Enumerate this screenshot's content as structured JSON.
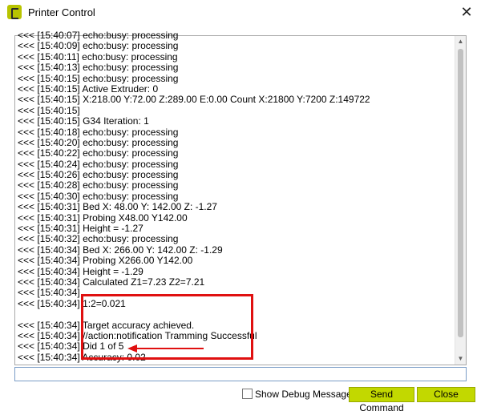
{
  "window": {
    "title": "Printer Control",
    "close_glyph": "✕",
    "icon": "cura-logo-icon"
  },
  "console": {
    "lines": [
      "<<< [15:40:07] echo:busy: processing",
      "<<< [15:40:09] echo:busy: processing",
      "<<< [15:40:11] echo:busy: processing",
      "<<< [15:40:13] echo:busy: processing",
      "<<< [15:40:15] echo:busy: processing",
      "<<< [15:40:15] Active Extruder: 0",
      "<<< [15:40:15] X:218.00 Y:72.00 Z:289.00 E:0.00 Count X:21800 Y:7200 Z:149722",
      "<<< [15:40:15]",
      "<<< [15:40:15] G34 Iteration: 1",
      "<<< [15:40:18] echo:busy: processing",
      "<<< [15:40:20] echo:busy: processing",
      "<<< [15:40:22] echo:busy: processing",
      "<<< [15:40:24] echo:busy: processing",
      "<<< [15:40:26] echo:busy: processing",
      "<<< [15:40:28] echo:busy: processing",
      "<<< [15:40:30] echo:busy: processing",
      "<<< [15:40:31] Bed X: 48.00 Y: 142.00 Z: -1.27",
      "<<< [15:40:31] Probing X48.00 Y142.00",
      "<<< [15:40:31] Height = -1.27",
      "<<< [15:40:32] echo:busy: processing",
      "<<< [15:40:34] Bed X: 266.00 Y: 142.00 Z: -1.29",
      "<<< [15:40:34] Probing X266.00 Y142.00",
      "<<< [15:40:34] Height = -1.29",
      "<<< [15:40:34] Calculated Z1=7.23 Z2=7.21",
      "<<< [15:40:34]",
      "<<< [15:40:34] 1:2=0.021",
      "",
      "<<< [15:40:34] Target accuracy achieved.",
      "<<< [15:40:34] //action:notification Tramming Successful",
      "<<< [15:40:34] Did 1 of 5",
      "<<< [15:40:34] Accuracy: 0.02"
    ]
  },
  "scrollbar": {
    "up_glyph": "▲",
    "down_glyph": "▼"
  },
  "command_input": {
    "value": "",
    "placeholder": ""
  },
  "footer": {
    "debug_label": "Show Debug Messages",
    "debug_checked": false,
    "send_label": "Send Command",
    "close_label": "Close"
  },
  "colors": {
    "accent": "#c2d800",
    "annotation": "#e01010"
  }
}
